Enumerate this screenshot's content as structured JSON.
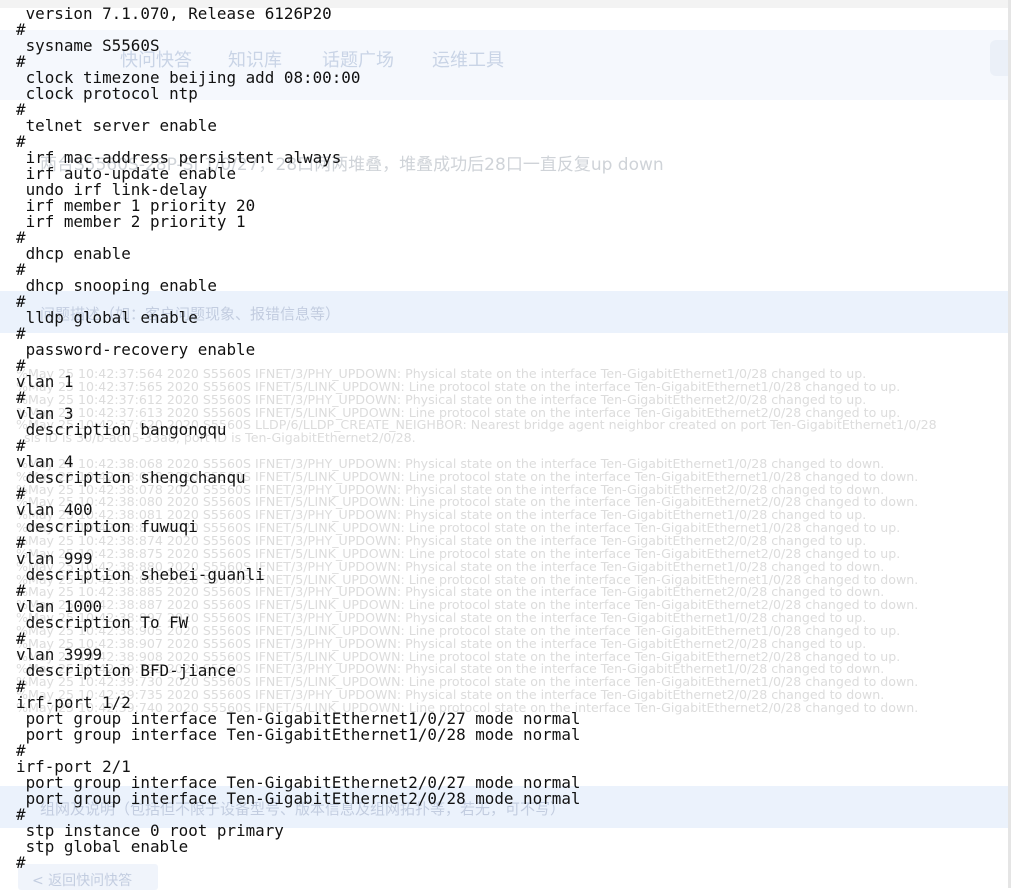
{
  "background_page": {
    "nav_items": [
      "快问快答",
      "知识库",
      "话题广场",
      "运维工具"
    ],
    "question_title": "两台S5560S-28P-SI 1/0/27，28口两两堆叠，堆叠成功后28口一直反复up down",
    "section_header": "问题描述（如：客户问题现象、报错信息等）",
    "section_header_2": "组网及说明（包括但不限于设备型号、版本信息及组网拓扑等，若无，可不写）",
    "back_link": "< 返回快问快答",
    "log_lines": [
      "%May 25 10:42:37:564 2020 S5560S IFNET/3/PHY_UPDOWN: Physical state on the interface Ten-GigabitEthernet1/0/28 changed to up.",
      "%May 25 10:42:37:565 2020 S5560S IFNET/5/LINK_UPDOWN: Line protocol state on the interface Ten-GigabitEthernet1/0/28 changed to up.",
      "%May 25 10:42:37:612 2020 S5560S IFNET/3/PHY_UPDOWN: Physical state on the interface Ten-GigabitEthernet2/0/28 changed to up.",
      "%May 25 10:42:37:613 2020 S5560S IFNET/5/LINK_UPDOWN: Line protocol state on the interface Ten-GigabitEthernet2/0/28 changed to up.",
      "%May 25 10:42:37:620 2020 S5560S LLDP/6/LLDP_CREATE_NEIGHBOR: Nearest bridge agent neighbor created on port Ten-GigabitEthernet1/0/28",
      "  sis ID is 30/b-ac05-33a8, port ID is Ten-GigabitEthernet2/0/28.",
      "",
      "%May 25 10:42:38:068 2020 S5560S IFNET/3/PHY_UPDOWN: Physical state on the interface Ten-GigabitEthernet1/0/28 changed to down.",
      "%May 25 10:42:38:078 2020 S5560S IFNET/5/LINK_UPDOWN: Line protocol state on the interface Ten-GigabitEthernet1/0/28 changed to down.",
      "%May 25 10:42:38:078 2020 S5560S IFNET/3/PHY_UPDOWN: Physical state on the interface Ten-GigabitEthernet2/0/28 changed to down.",
      "%May 25 10:42:38:080 2020 S5560S IFNET/5/LINK_UPDOWN: Line protocol state on the interface Ten-GigabitEthernet2/0/28 changed to down.",
      "%May 25 10:42:38:081 2020 S5560S IFNET/3/PHY_UPDOWN: Physical state on the interface Ten-GigabitEthernet1/0/28 changed to up.",
      "%May 25 10:42:38:871 2020 S5560S IFNET/5/LINK_UPDOWN: Line protocol state on the interface Ten-GigabitEthernet1/0/28 changed to up.",
      "%May 25 10:42:38:874 2020 S5560S IFNET/3/PHY_UPDOWN: Physical state on the interface Ten-GigabitEthernet2/0/28 changed to up.",
      "%May 25 10:42:38:875 2020 S5560S IFNET/5/LINK_UPDOWN: Line protocol state on the interface Ten-GigabitEthernet2/0/28 changed to up.",
      "%May 25 10:42:38:880 2020 S5560S IFNET/3/PHY_UPDOWN: Physical state on the interface Ten-GigabitEthernet1/0/28 changed to down.",
      "%May 25 10:42:38:883 2020 S5560S IFNET/5/LINK_UPDOWN: Line protocol state on the interface Ten-GigabitEthernet1/0/28 changed to down.",
      "%May 25 10:42:38:885 2020 S5560S IFNET/3/PHY_UPDOWN: Physical state on the interface Ten-GigabitEthernet2/0/28 changed to down.",
      "%May 25 10:42:38:887 2020 S5560S IFNET/5/LINK_UPDOWN: Line protocol state on the interface Ten-GigabitEthernet2/0/28 changed to down.",
      "%May 25 10:42:38:897 2020 S5560S IFNET/3/PHY_UPDOWN: Physical state on the interface Ten-GigabitEthernet1/0/28 changed to up.",
      "%May 25 10:42:38:905 2020 S5560S IFNET/5/LINK_UPDOWN: Line protocol state on the interface Ten-GigabitEthernet1/0/28 changed to up.",
      "%May 25 10:42:38:907 2020 S5560S IFNET/3/PHY_UPDOWN: Physical state on the interface Ten-GigabitEthernet2/0/28 changed to up.",
      "%May 25 10:42:38:908 2020 S5560S IFNET/5/LINK_UPDOWN: Line protocol state on the interface Ten-GigabitEthernet2/0/28 changed to up.",
      "%May 25 10:42:39:725 2020 S5560S IFNET/3/PHY_UPDOWN: Physical state on the interface Ten-GigabitEthernet1/0/28 changed to down.",
      "%May 25 10:42:39:730 2020 S5560S IFNET/5/LINK_UPDOWN: Line protocol state on the interface Ten-GigabitEthernet1/0/28 changed to down.",
      "%May 25 10:42:39:735 2020 S5560S IFNET/3/PHY_UPDOWN: Physical state on the interface Ten-GigabitEthernet2/0/28 changed to down.",
      "%May 25 10:42:39:740 2020 S5560S IFNET/5/LINK_UPDOWN: Line protocol state on the interface Ten-GigabitEthernet2/0/28 changed to down."
    ]
  },
  "config_lines": [
    " version 7.1.070, Release 6126P20",
    "#",
    " sysname S5560S",
    "#",
    " clock timezone beijing add 08:00:00",
    " clock protocol ntp",
    "#",
    " telnet server enable",
    "#",
    " irf mac-address persistent always",
    " irf auto-update enable",
    " undo irf link-delay",
    " irf member 1 priority 20",
    " irf member 2 priority 1",
    "#",
    " dhcp enable",
    "#",
    " dhcp snooping enable",
    "#",
    " lldp global enable",
    "#",
    " password-recovery enable",
    "#",
    "vlan 1",
    "#",
    "vlan 3",
    " description bangongqu",
    "#",
    "vlan 4",
    " description shengchanqu",
    "#",
    "vlan 400",
    " description fuwuqi",
    "#",
    "vlan 999",
    " description shebei-guanli",
    "#",
    "vlan 1000",
    " description To FW",
    "#",
    "vlan 3999",
    " description BFD-jiance",
    "#",
    "irf-port 1/2",
    " port group interface Ten-GigabitEthernet1/0/27 mode normal",
    " port group interface Ten-GigabitEthernet1/0/28 mode normal",
    "#",
    "irf-port 2/1",
    " port group interface Ten-GigabitEthernet2/0/27 mode normal",
    " port group interface Ten-GigabitEthernet2/0/28 mode normal",
    "#",
    " stp instance 0 root primary",
    " stp global enable",
    "#"
  ]
}
